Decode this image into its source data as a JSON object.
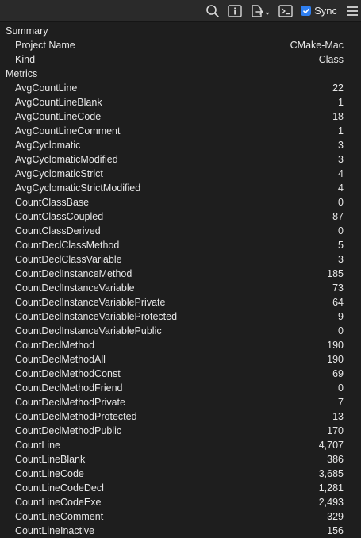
{
  "toolbar": {
    "sync_label": "Sync",
    "sync_checked": true
  },
  "sections": [
    {
      "title": "Summary",
      "rows": [
        {
          "label": "Project Name",
          "value": "CMake-Mac"
        },
        {
          "label": "Kind",
          "value": "Class"
        }
      ]
    },
    {
      "title": "Metrics",
      "rows": [
        {
          "label": "AvgCountLine",
          "value": "22"
        },
        {
          "label": "AvgCountLineBlank",
          "value": "1"
        },
        {
          "label": "AvgCountLineCode",
          "value": "18"
        },
        {
          "label": "AvgCountLineComment",
          "value": "1"
        },
        {
          "label": "AvgCyclomatic",
          "value": "3"
        },
        {
          "label": "AvgCyclomaticModified",
          "value": "3"
        },
        {
          "label": "AvgCyclomaticStrict",
          "value": "4"
        },
        {
          "label": "AvgCyclomaticStrictModified",
          "value": "4"
        },
        {
          "label": "CountClassBase",
          "value": "0"
        },
        {
          "label": "CountClassCoupled",
          "value": "87"
        },
        {
          "label": "CountClassDerived",
          "value": "0"
        },
        {
          "label": "CountDeclClassMethod",
          "value": "5"
        },
        {
          "label": "CountDeclClassVariable",
          "value": "3"
        },
        {
          "label": "CountDeclInstanceMethod",
          "value": "185"
        },
        {
          "label": "CountDeclInstanceVariable",
          "value": "73"
        },
        {
          "label": "CountDeclInstanceVariablePrivate",
          "value": "64"
        },
        {
          "label": "CountDeclInstanceVariableProtected",
          "value": "9"
        },
        {
          "label": "CountDeclInstanceVariablePublic",
          "value": "0"
        },
        {
          "label": "CountDeclMethod",
          "value": "190"
        },
        {
          "label": "CountDeclMethodAll",
          "value": "190"
        },
        {
          "label": "CountDeclMethodConst",
          "value": "69"
        },
        {
          "label": "CountDeclMethodFriend",
          "value": "0"
        },
        {
          "label": "CountDeclMethodPrivate",
          "value": "7"
        },
        {
          "label": "CountDeclMethodProtected",
          "value": "13"
        },
        {
          "label": "CountDeclMethodPublic",
          "value": "170"
        },
        {
          "label": "CountLine",
          "value": "4,707"
        },
        {
          "label": "CountLineBlank",
          "value": "386"
        },
        {
          "label": "CountLineCode",
          "value": "3,685"
        },
        {
          "label": "CountLineCodeDecl",
          "value": "1,281"
        },
        {
          "label": "CountLineCodeExe",
          "value": "2,493"
        },
        {
          "label": "CountLineComment",
          "value": "329"
        },
        {
          "label": "CountLineInactive",
          "value": "156"
        }
      ]
    }
  ]
}
